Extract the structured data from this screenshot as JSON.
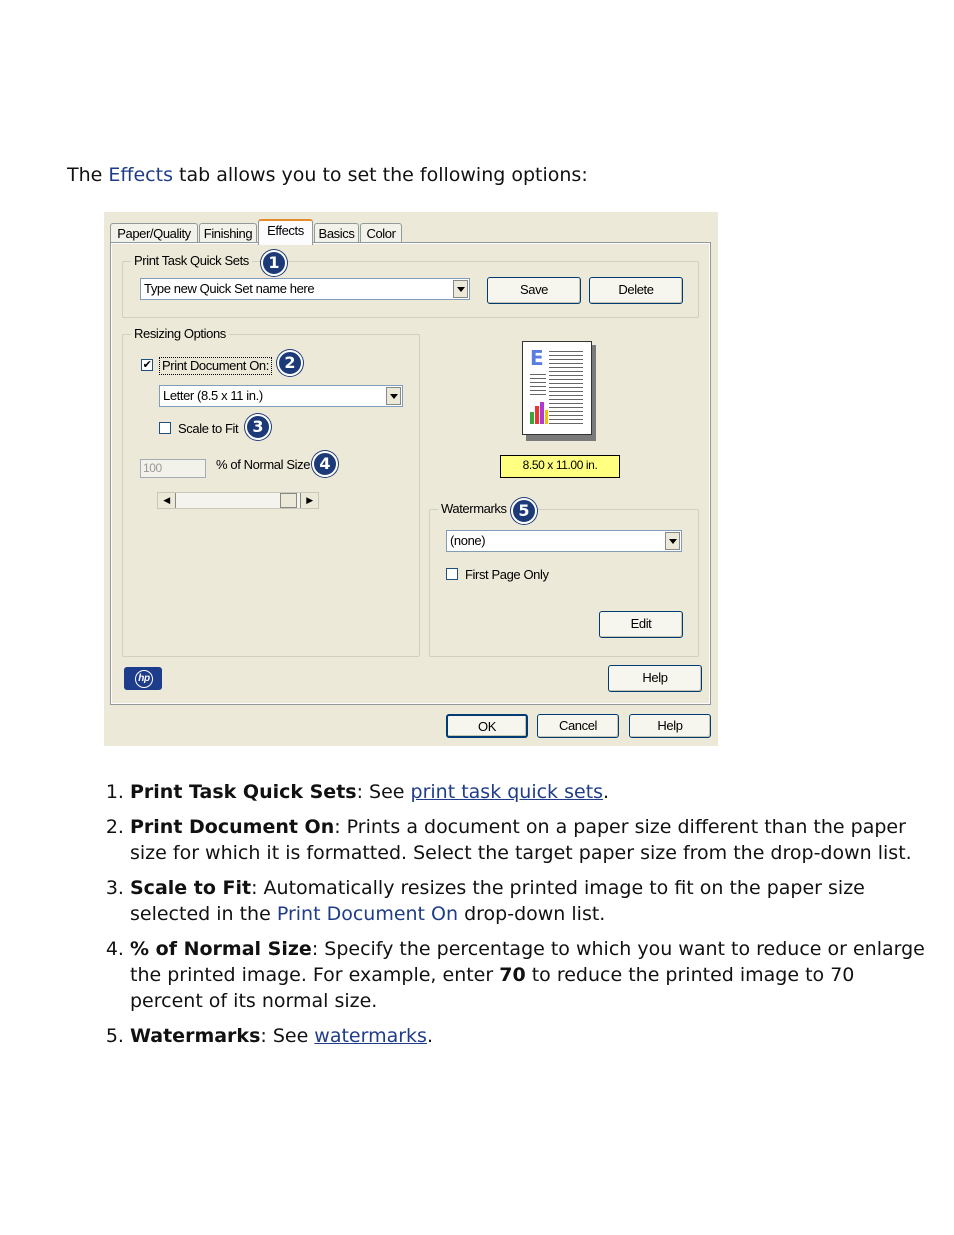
{
  "intro": {
    "before": "The ",
    "keyword": "Effects",
    "after": " tab allows you to set the following options:"
  },
  "dialog": {
    "tabs": [
      "Paper/Quality",
      "Finishing",
      "Effects",
      "Basics",
      "Color"
    ],
    "active_tab": "Effects",
    "quick_sets": {
      "label": "Print Task Quick Sets",
      "value": "Type new Quick Set name here",
      "save": "Save",
      "delete": "Delete"
    },
    "resizing": {
      "label": "Resizing Options",
      "print_doc_label": "Print Document On:",
      "print_doc_checked": true,
      "paper_value": "Letter (8.5 x 11 in.)",
      "scale_label": "Scale to Fit",
      "scale_checked": false,
      "percent_value": "100",
      "percent_label": "% of Normal Size"
    },
    "preview_size": "8.50 x 11.00 in.",
    "watermarks": {
      "label": "Watermarks",
      "value": "(none)",
      "first_page": "First Page Only",
      "edit": "Edit"
    },
    "help_inner": "Help",
    "buttons": {
      "ok": "OK",
      "cancel": "Cancel",
      "help": "Help"
    },
    "badges": [
      "1",
      "2",
      "3",
      "4",
      "5"
    ],
    "colors": {
      "badge": "#1d3a78",
      "accent": "#e68b2c",
      "dialog_bg": "#ece9d8"
    }
  },
  "items": [
    {
      "term": "Print Task Quick Sets",
      "sep": ": See ",
      "link": "print task quick sets",
      "end": "."
    },
    {
      "term": "Print Document On",
      "text": ": Prints a document on a paper size different than the paper size for which it is formatted. Select the target paper size from the drop-down list."
    },
    {
      "term": "Scale to Fit",
      "text1": ": Automatically resizes the printed image to fit on the paper size selected in the ",
      "kw": "Print Document On",
      "text2": " drop-down list."
    },
    {
      "term": "% of Normal Size",
      "text1": ": Specify the percentage to which you want to reduce or enlarge the printed image. For example, enter ",
      "bold": "70",
      "text2": " to reduce the printed image to 70 percent of its normal size."
    },
    {
      "term": "Watermarks",
      "sep": ": See ",
      "link": "watermarks",
      "end": "."
    }
  ]
}
